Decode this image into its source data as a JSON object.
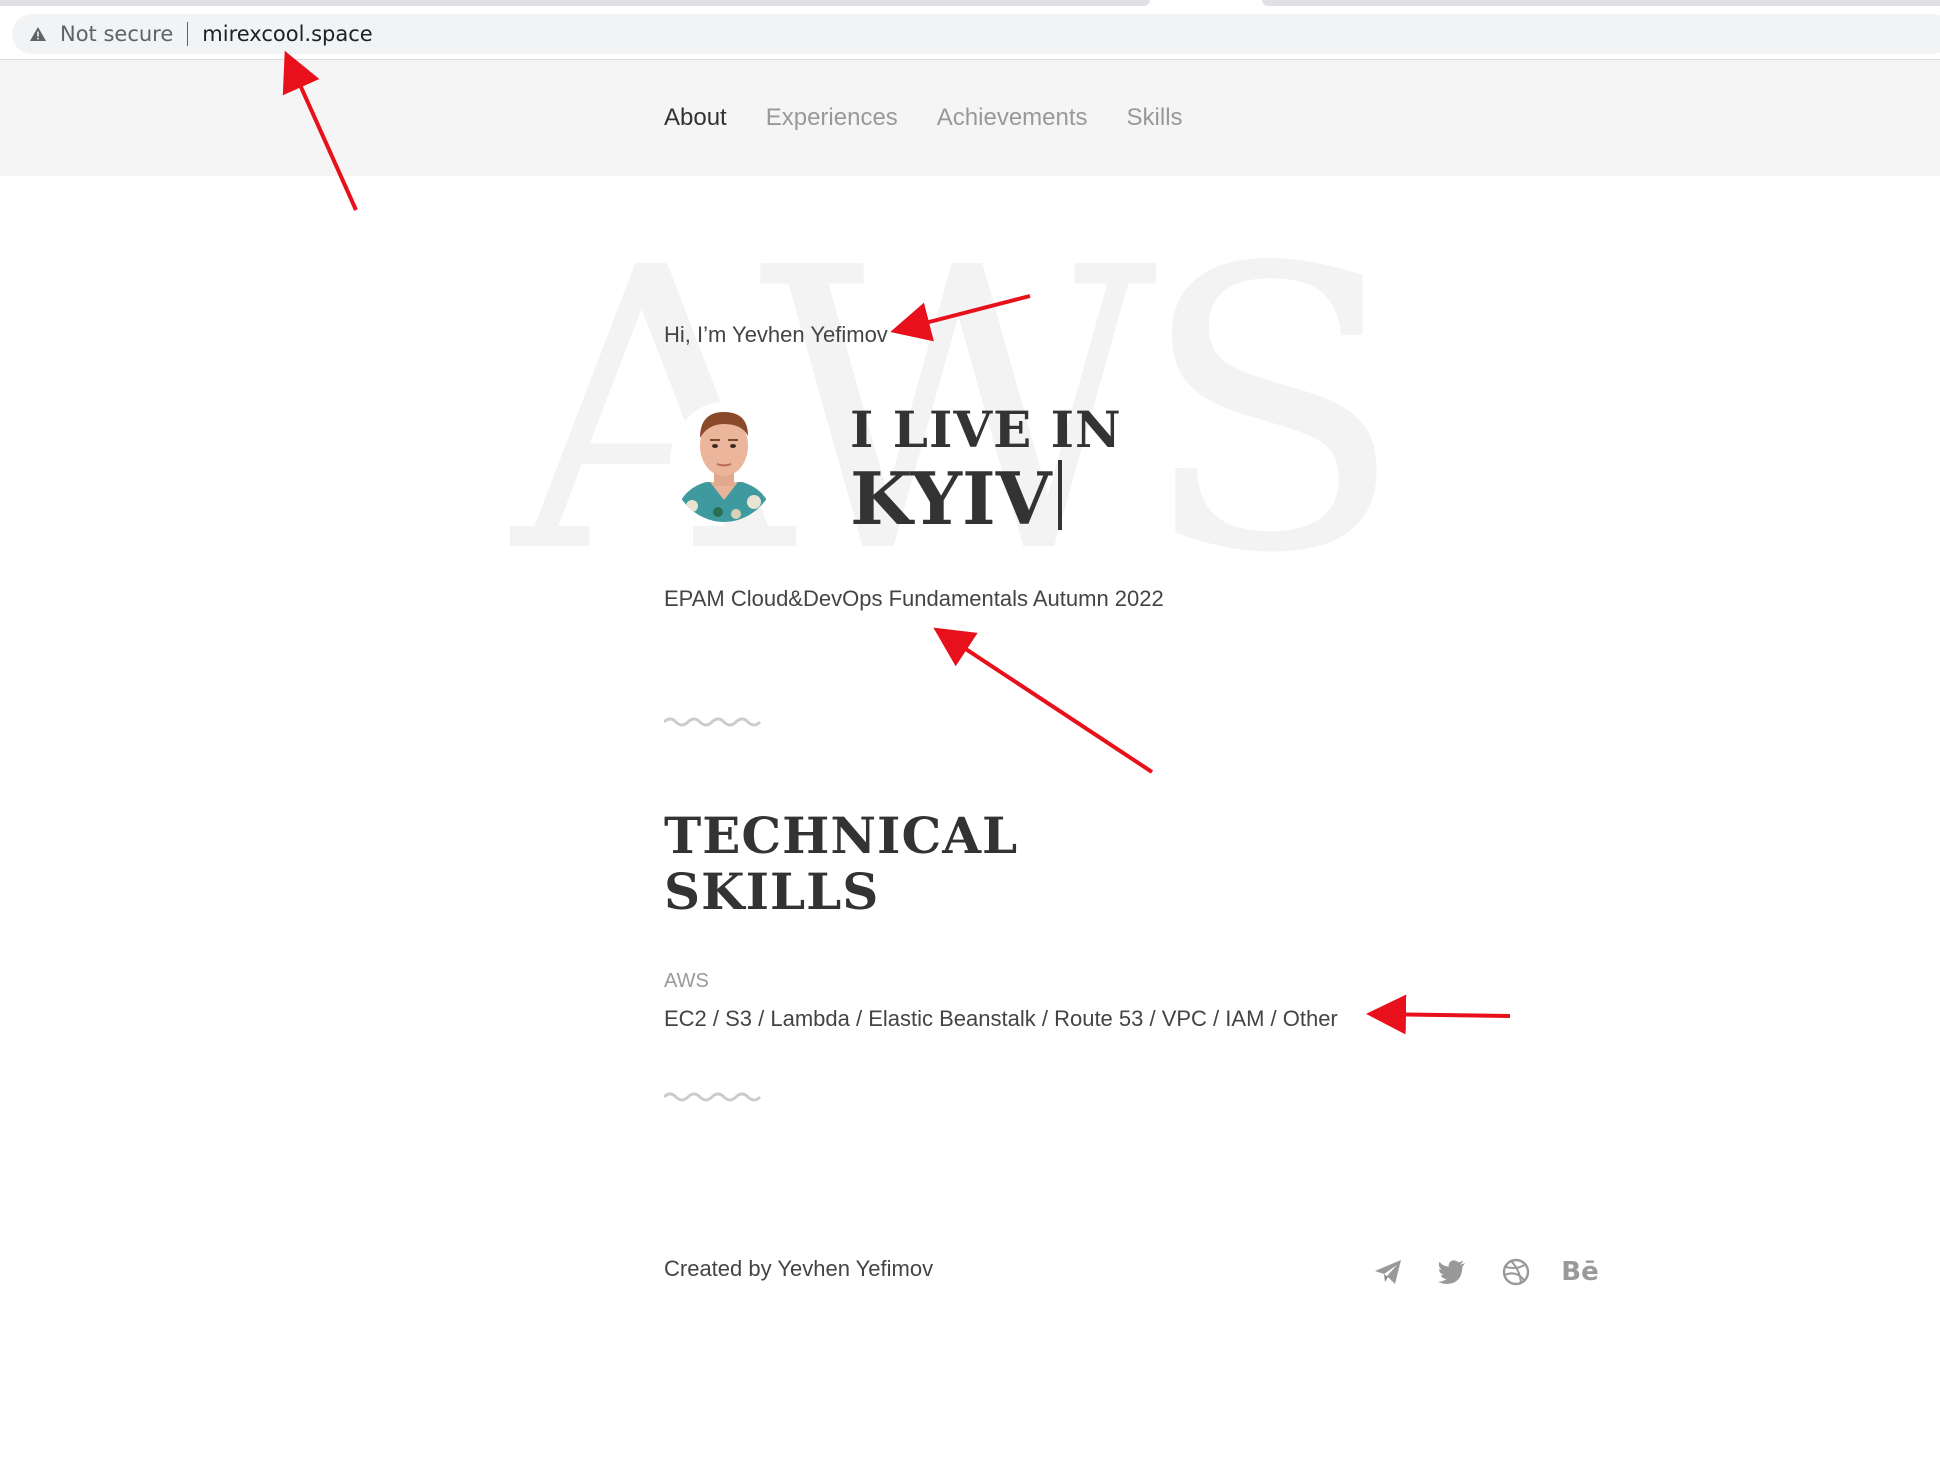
{
  "browser": {
    "security_text": "Not secure",
    "url": "mirexcool.space",
    "icons": {
      "security": "warning-triangle-icon"
    }
  },
  "nav": {
    "items": [
      {
        "label": "About",
        "active": true
      },
      {
        "label": "Experiences",
        "active": false
      },
      {
        "label": "Achievements",
        "active": false
      },
      {
        "label": "Skills",
        "active": false
      }
    ]
  },
  "hero": {
    "background_word": "AWS",
    "greeting": "Hi, I’m Yevhen Yefimov",
    "live_prefix": "I LIVE IN",
    "city": "KYIV",
    "course": "EPAM Cloud&DevOps Fundamentals Autumn 2022"
  },
  "skills": {
    "title_line1": "TECHNICAL",
    "title_line2": "SKILLS",
    "category": "AWS",
    "list": "EC2 / S3 / Lambda / Elastic Beanstalk / Route 53 / VPC / IAM / Other"
  },
  "footer": {
    "credit": "Created by Yevhen Yefimov",
    "social_icons": [
      "telegram-icon",
      "twitter-icon",
      "dribbble-icon",
      "behance-icon"
    ],
    "behance_text": "Bē"
  },
  "colors": {
    "annotation_arrow": "#e8101a",
    "nav_active": "#333333",
    "nav_inactive": "#999999",
    "header_bg": "#f5f5f5"
  }
}
